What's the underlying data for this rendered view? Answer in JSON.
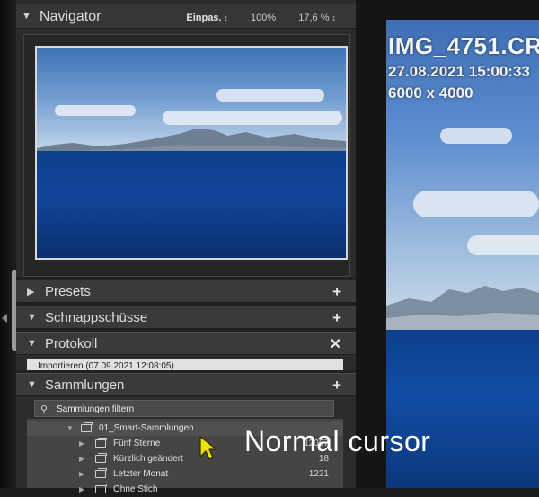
{
  "navigator": {
    "title": "Navigator",
    "zoom_fit": "Einpas.",
    "zoom_fit_caret": "↕",
    "zoom_100": "100%",
    "zoom_other": "17,6 %",
    "zoom_other_caret": "↕"
  },
  "panels": {
    "presets": "Presets",
    "snapshots": "Schnappschüsse",
    "history": "Protokoll",
    "collections": "Sammlungen"
  },
  "history": {
    "entry": "Importieren (07.09.2021 12:08:05)"
  },
  "collections": {
    "filter_placeholder": "Sammlungen filtern",
    "parent": "01_Smart-Sammlungen",
    "items": [
      {
        "label": "Fünf Sterne",
        "count": "12067"
      },
      {
        "label": "Kürzlich geändert",
        "count": "18"
      },
      {
        "label": "Letzter Monat",
        "count": "1221"
      },
      {
        "label": "Ohne Stich",
        "count": ""
      }
    ]
  },
  "caption": "Normal cursor",
  "photo": {
    "filename": "IMG_4751.CR",
    "datetime": "27.08.2021 15:00:33",
    "dimensions": "6000 x 4000"
  },
  "icons": {
    "expand": "triangle-down-icon",
    "collapse": "triangle-right-icon",
    "add": "plus-icon",
    "close": "close-icon",
    "search": "search-icon",
    "collection": "smart-collection-icon",
    "cursor": "arrow-cursor-icon"
  },
  "colors": {
    "panel_bg": "#2c2c2c",
    "header_bg": "#3a3a3a",
    "cursor_fill": "#e8e200",
    "history_selected": "#e1e1e1"
  }
}
